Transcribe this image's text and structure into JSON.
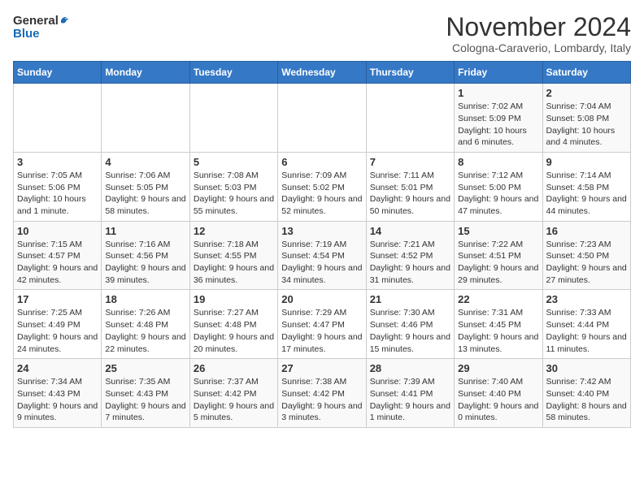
{
  "logo": {
    "text_general": "General",
    "text_blue": "Blue"
  },
  "header": {
    "title": "November 2024",
    "subtitle": "Cologna-Caraverio, Lombardy, Italy"
  },
  "calendar": {
    "days_of_week": [
      "Sunday",
      "Monday",
      "Tuesday",
      "Wednesday",
      "Thursday",
      "Friday",
      "Saturday"
    ],
    "weeks": [
      [
        {
          "day": "",
          "info": ""
        },
        {
          "day": "",
          "info": ""
        },
        {
          "day": "",
          "info": ""
        },
        {
          "day": "",
          "info": ""
        },
        {
          "day": "",
          "info": ""
        },
        {
          "day": "1",
          "info": "Sunrise: 7:02 AM\nSunset: 5:09 PM\nDaylight: 10 hours and 6 minutes."
        },
        {
          "day": "2",
          "info": "Sunrise: 7:04 AM\nSunset: 5:08 PM\nDaylight: 10 hours and 4 minutes."
        }
      ],
      [
        {
          "day": "3",
          "info": "Sunrise: 7:05 AM\nSunset: 5:06 PM\nDaylight: 10 hours and 1 minute."
        },
        {
          "day": "4",
          "info": "Sunrise: 7:06 AM\nSunset: 5:05 PM\nDaylight: 9 hours and 58 minutes."
        },
        {
          "day": "5",
          "info": "Sunrise: 7:08 AM\nSunset: 5:03 PM\nDaylight: 9 hours and 55 minutes."
        },
        {
          "day": "6",
          "info": "Sunrise: 7:09 AM\nSunset: 5:02 PM\nDaylight: 9 hours and 52 minutes."
        },
        {
          "day": "7",
          "info": "Sunrise: 7:11 AM\nSunset: 5:01 PM\nDaylight: 9 hours and 50 minutes."
        },
        {
          "day": "8",
          "info": "Sunrise: 7:12 AM\nSunset: 5:00 PM\nDaylight: 9 hours and 47 minutes."
        },
        {
          "day": "9",
          "info": "Sunrise: 7:14 AM\nSunset: 4:58 PM\nDaylight: 9 hours and 44 minutes."
        }
      ],
      [
        {
          "day": "10",
          "info": "Sunrise: 7:15 AM\nSunset: 4:57 PM\nDaylight: 9 hours and 42 minutes."
        },
        {
          "day": "11",
          "info": "Sunrise: 7:16 AM\nSunset: 4:56 PM\nDaylight: 9 hours and 39 minutes."
        },
        {
          "day": "12",
          "info": "Sunrise: 7:18 AM\nSunset: 4:55 PM\nDaylight: 9 hours and 36 minutes."
        },
        {
          "day": "13",
          "info": "Sunrise: 7:19 AM\nSunset: 4:54 PM\nDaylight: 9 hours and 34 minutes."
        },
        {
          "day": "14",
          "info": "Sunrise: 7:21 AM\nSunset: 4:52 PM\nDaylight: 9 hours and 31 minutes."
        },
        {
          "day": "15",
          "info": "Sunrise: 7:22 AM\nSunset: 4:51 PM\nDaylight: 9 hours and 29 minutes."
        },
        {
          "day": "16",
          "info": "Sunrise: 7:23 AM\nSunset: 4:50 PM\nDaylight: 9 hours and 27 minutes."
        }
      ],
      [
        {
          "day": "17",
          "info": "Sunrise: 7:25 AM\nSunset: 4:49 PM\nDaylight: 9 hours and 24 minutes."
        },
        {
          "day": "18",
          "info": "Sunrise: 7:26 AM\nSunset: 4:48 PM\nDaylight: 9 hours and 22 minutes."
        },
        {
          "day": "19",
          "info": "Sunrise: 7:27 AM\nSunset: 4:48 PM\nDaylight: 9 hours and 20 minutes."
        },
        {
          "day": "20",
          "info": "Sunrise: 7:29 AM\nSunset: 4:47 PM\nDaylight: 9 hours and 17 minutes."
        },
        {
          "day": "21",
          "info": "Sunrise: 7:30 AM\nSunset: 4:46 PM\nDaylight: 9 hours and 15 minutes."
        },
        {
          "day": "22",
          "info": "Sunrise: 7:31 AM\nSunset: 4:45 PM\nDaylight: 9 hours and 13 minutes."
        },
        {
          "day": "23",
          "info": "Sunrise: 7:33 AM\nSunset: 4:44 PM\nDaylight: 9 hours and 11 minutes."
        }
      ],
      [
        {
          "day": "24",
          "info": "Sunrise: 7:34 AM\nSunset: 4:43 PM\nDaylight: 9 hours and 9 minutes."
        },
        {
          "day": "25",
          "info": "Sunrise: 7:35 AM\nSunset: 4:43 PM\nDaylight: 9 hours and 7 minutes."
        },
        {
          "day": "26",
          "info": "Sunrise: 7:37 AM\nSunset: 4:42 PM\nDaylight: 9 hours and 5 minutes."
        },
        {
          "day": "27",
          "info": "Sunrise: 7:38 AM\nSunset: 4:42 PM\nDaylight: 9 hours and 3 minutes."
        },
        {
          "day": "28",
          "info": "Sunrise: 7:39 AM\nSunset: 4:41 PM\nDaylight: 9 hours and 1 minute."
        },
        {
          "day": "29",
          "info": "Sunrise: 7:40 AM\nSunset: 4:40 PM\nDaylight: 9 hours and 0 minutes."
        },
        {
          "day": "30",
          "info": "Sunrise: 7:42 AM\nSunset: 4:40 PM\nDaylight: 8 hours and 58 minutes."
        }
      ]
    ]
  }
}
